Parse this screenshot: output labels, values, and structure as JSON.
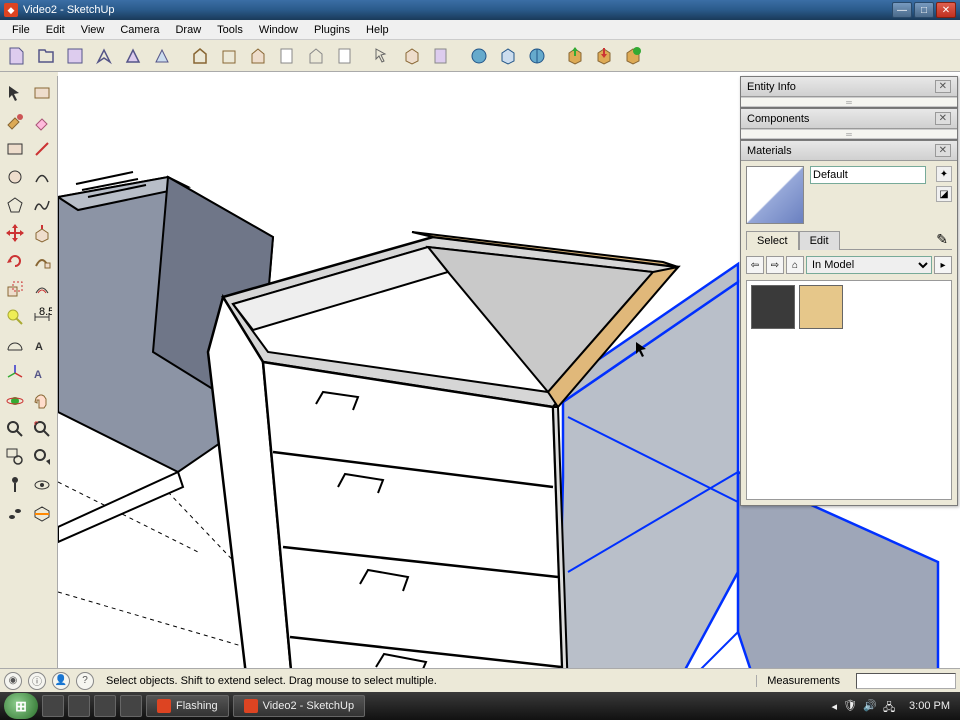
{
  "window": {
    "title": "Video2 - SketchUp"
  },
  "menu": {
    "items": [
      "File",
      "Edit",
      "View",
      "Camera",
      "Draw",
      "Tools",
      "Window",
      "Plugins",
      "Help"
    ]
  },
  "panels": {
    "entity_info": {
      "title": "Entity Info"
    },
    "components": {
      "title": "Components"
    },
    "materials": {
      "title": "Materials",
      "current_name": "Default",
      "tabs": {
        "select": "Select",
        "edit": "Edit"
      },
      "library": "In Model",
      "swatches": [
        "dark",
        "tan"
      ]
    }
  },
  "status": {
    "hint": "Select objects. Shift to extend select. Drag mouse to select multiple.",
    "measurements": "Measurements"
  },
  "taskbar": {
    "tasks": [
      {
        "label": "Flashing"
      },
      {
        "label": "Video2 - SketchUp"
      }
    ],
    "clock": "3:00 PM"
  },
  "toolbar_left": {
    "tools": [
      [
        "select",
        "eraser"
      ],
      [
        "paint",
        "eraser2"
      ],
      [
        "rect",
        "line"
      ],
      [
        "circle",
        "arc"
      ],
      [
        "poly",
        "freehand"
      ],
      [
        "move",
        "rotate"
      ],
      [
        "scale",
        "offset"
      ],
      [
        "pushpull",
        "followme"
      ],
      [
        "tape",
        "dim"
      ],
      [
        "text",
        "axes"
      ],
      [
        "orbit",
        "pan"
      ],
      [
        "zoom",
        "zoom-ext"
      ],
      [
        "zoom-win",
        "prev"
      ],
      [
        "walk",
        "look"
      ],
      [
        "position",
        "section"
      ]
    ]
  },
  "toolbar_main": {
    "buttons": [
      "new",
      "open",
      "save",
      "cut",
      "copy",
      "paste",
      "undo",
      "redo",
      "print",
      "model-info",
      "sep",
      "component",
      "group",
      "explode",
      "sep",
      "orbit2",
      "pan2",
      "zoom2",
      "sep",
      "3dw-get",
      "3dw-share",
      "3dw-browse",
      "sep",
      "layers",
      "outliner",
      "scenes",
      "sep",
      "shadows"
    ]
  }
}
